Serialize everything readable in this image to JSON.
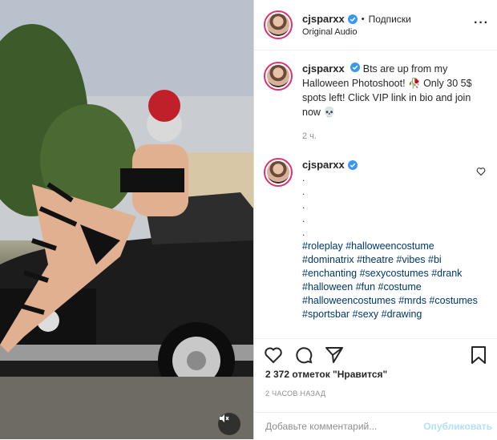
{
  "post": {
    "username": "cjsparxx",
    "follow_status": "Подписки",
    "audio": "Original Audio",
    "caption": "Bts are up from my Halloween Photoshoot! 🥀 Only 30 5$ spots left! Click VIP link in bio and join now 💀",
    "caption_time": "2 ч.",
    "second_comment_dots": [
      ".",
      ".",
      ".",
      ".",
      "."
    ],
    "hashtags": "#roleplay #halloweencostume #dominatrix #theatre #vibes #bi #enchanting #sexycostumes #drank #halloween #fun #costume #halloweencostumes #mrds #costumes #sportsbar #sexy #drawing",
    "likes": "2 372 отметок \"Нравится\"",
    "time_ago": "2 ЧАСОВ НАЗАД",
    "comment_placeholder": "Добавьте комментарий...",
    "publish_label": "Опубликовать"
  },
  "colors": {
    "verified": "#3897f0",
    "link": "#00376b",
    "publish": "#b2dffc",
    "ring": "#e1306c"
  },
  "icons": [
    "verified-icon",
    "more-icon",
    "heart-icon",
    "comment-icon",
    "share-icon",
    "bookmark-icon",
    "mute-icon"
  ]
}
